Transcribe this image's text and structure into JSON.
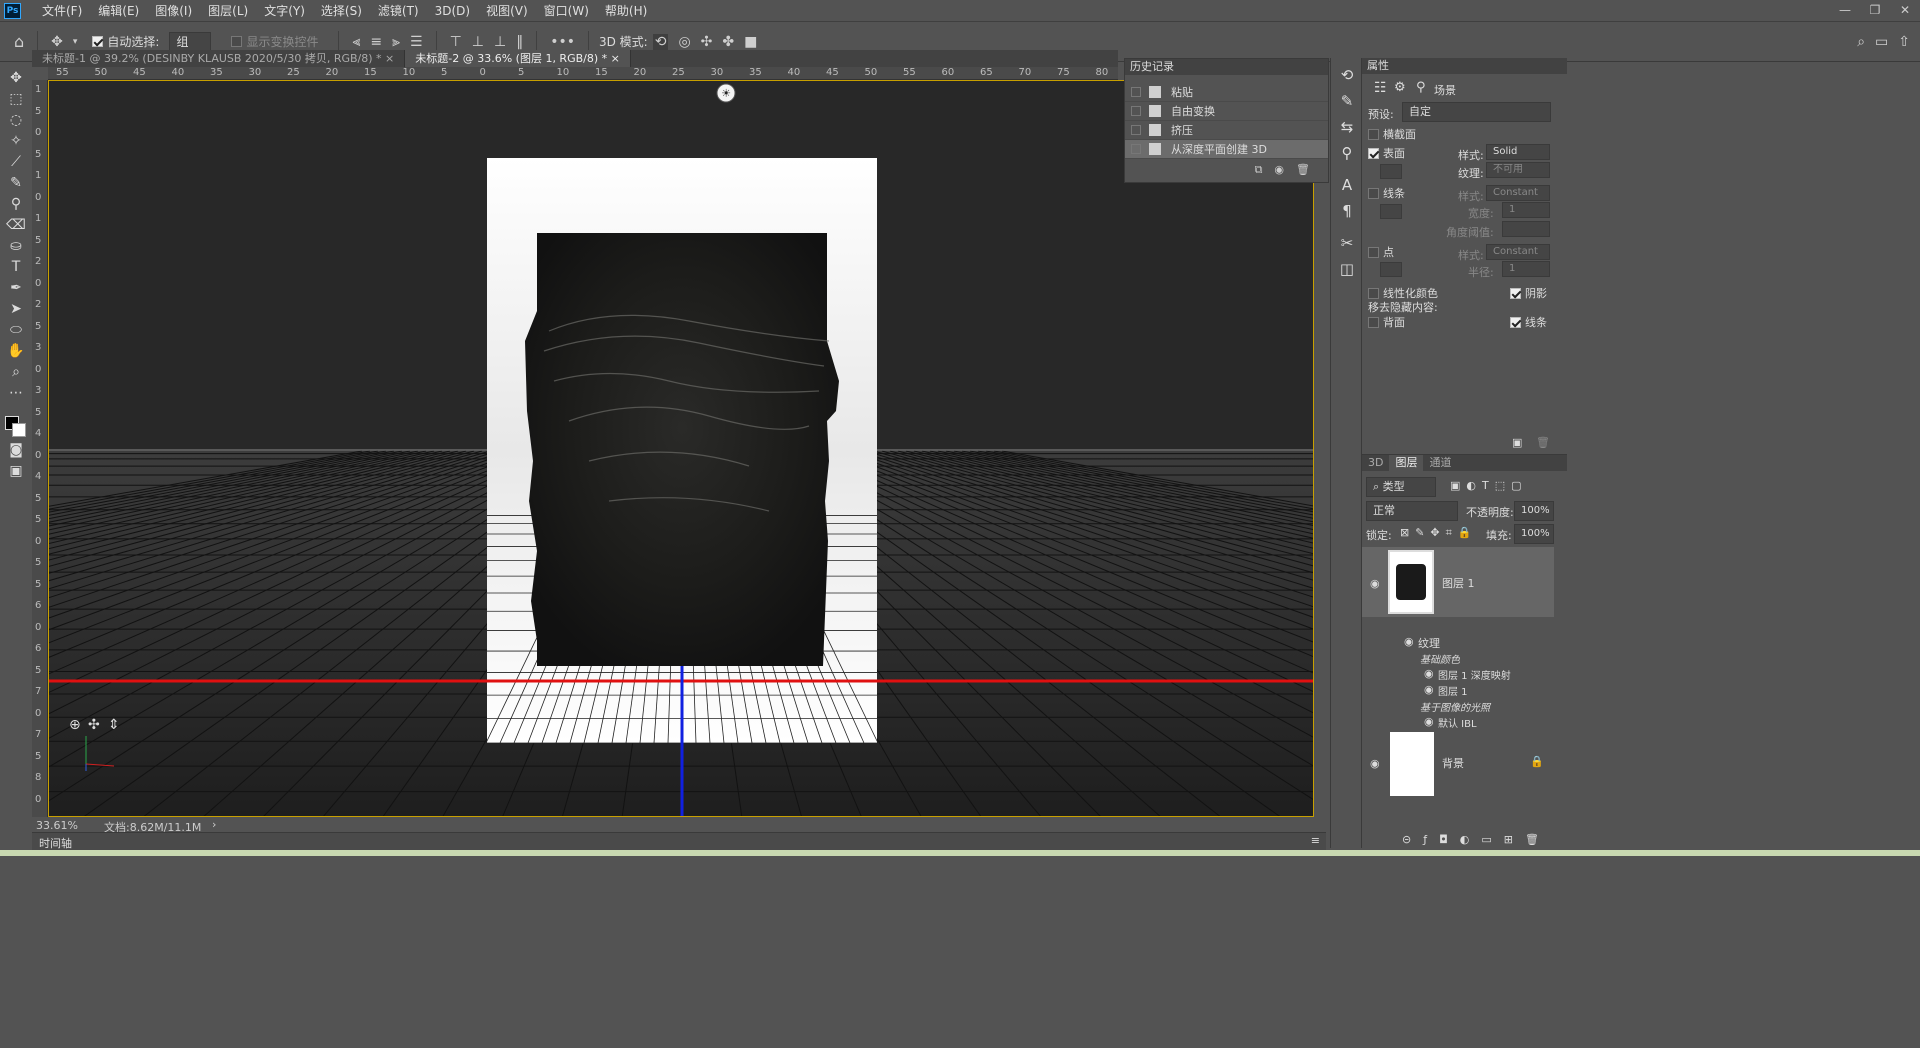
{
  "app": {
    "logo": "Ps"
  },
  "menu": [
    "文件(F)",
    "编辑(E)",
    "图像(I)",
    "图层(L)",
    "文字(Y)",
    "选择(S)",
    "滤镜(T)",
    "3D(D)",
    "视图(V)",
    "窗口(W)",
    "帮助(H)"
  ],
  "options": {
    "auto_select_label": "自动选择:",
    "auto_select_value": "组",
    "transform_controls_label": "显示变换控件",
    "more": "•••",
    "mode_3d_label": "3D 模式:"
  },
  "tabs": [
    {
      "label": "未标题-1 @ 39.2% (DESINBY KLAUSB    2020/5/30 拷贝, RGB/8) *",
      "close": "×"
    },
    {
      "label": "未标题-2 @ 33.6% (图层 1, RGB/8) *",
      "close": "×"
    }
  ],
  "ruler_h": [
    "55",
    "50",
    "45",
    "40",
    "35",
    "30",
    "25",
    "20",
    "15",
    "10",
    "5",
    "0",
    "5",
    "10",
    "15",
    "20",
    "25",
    "30",
    "35",
    "40",
    "45",
    "50",
    "55",
    "60",
    "65",
    "70",
    "75",
    "80"
  ],
  "ruler_v": [
    "1",
    "5",
    "0",
    "5",
    "1",
    "0",
    "1",
    "5",
    "2",
    "0",
    "2",
    "5",
    "3",
    "0",
    "3",
    "5",
    "4",
    "0",
    "4",
    "5",
    "5",
    "0",
    "5",
    "5",
    "6",
    "0",
    "6",
    "5",
    "7",
    "0",
    "7",
    "5",
    "8",
    "0"
  ],
  "status": {
    "zoom": "33.61%",
    "doc": "文档:8.62M/11.1M",
    "arrow": "›"
  },
  "timeline": {
    "label": "时间轴"
  },
  "history": {
    "title": "历史记录",
    "items": [
      "粘贴",
      "自由变换",
      "挤压",
      "从深度平面创建 3D"
    ],
    "selected_index": 3
  },
  "properties": {
    "title": "属性",
    "scene_label": "场景",
    "preset_label": "预设:",
    "preset_value": "自定",
    "cross_section": "横截面",
    "surface": "表面",
    "style_label": "样式:",
    "surface_style": "Solid",
    "texture_label": "纹理:",
    "texture_value": "不可用",
    "lines": "线条",
    "lines_style": "Constant",
    "width_label": "宽度:",
    "width_value": "1",
    "angle_label": "角度阈值:",
    "points": "点",
    "points_style": "Constant",
    "radius_label": "半径:",
    "radius_value": "1",
    "linearize": "线性化颜色",
    "shadow": "阴影",
    "remove_hidden": "移去隐藏内容:",
    "backface": "背面",
    "lines2": "线条"
  },
  "layers_panel": {
    "tabs": [
      "3D",
      "图层",
      "通道"
    ],
    "filter": "类型",
    "blend": "正常",
    "opacity_label": "不透明度:",
    "opacity": "100%",
    "lock_label": "锁定:",
    "fill_label": "填充:",
    "fill": "100%",
    "layer1": "图层 1",
    "texture": "纹理",
    "base_color": "基础颜色",
    "sub1": "图层 1 深度映射",
    "sub2": "图层 1",
    "ibl": "基于图像的光照",
    "default_ibl": "默认 IBL",
    "background": "背景"
  },
  "colors": {
    "guide_red": "#e01010",
    "axis_blue": "#1020e0",
    "canvas_border": "#c8a000"
  }
}
